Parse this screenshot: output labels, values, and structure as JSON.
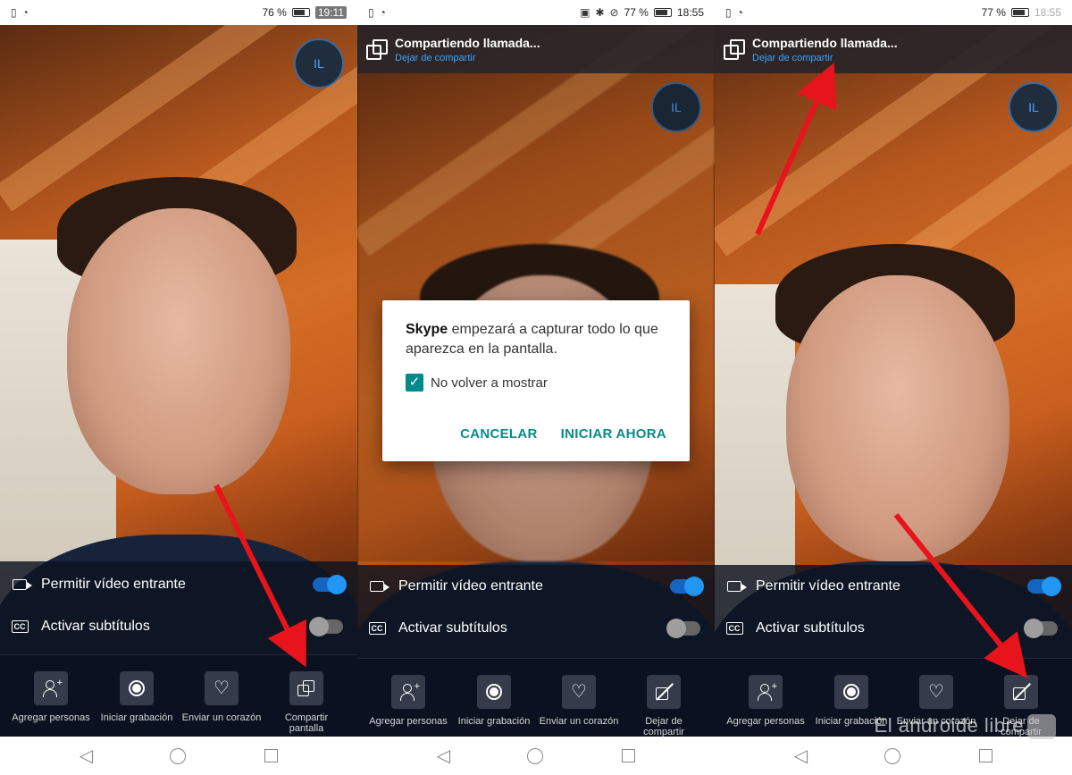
{
  "panels": [
    {
      "status": {
        "battery": "76 %",
        "time": "19:11"
      },
      "avatar": "IL",
      "settings": [
        {
          "label": "Permitir vídeo entrante",
          "on": true
        },
        {
          "label": "Activar subtítulos",
          "on": false
        }
      ],
      "actions": [
        {
          "label": "Agregar personas",
          "icon": "add-person-icon"
        },
        {
          "label": "Iniciar grabación",
          "icon": "record-icon"
        },
        {
          "label": "Enviar un corazón",
          "icon": "heart-icon"
        },
        {
          "label": "Compartir pantalla",
          "icon": "share-screen-icon"
        }
      ]
    },
    {
      "status": {
        "battery": "77 %",
        "time": "18:55"
      },
      "banner": {
        "title": "Compartiendo llamada...",
        "link": "Dejar de compartir"
      },
      "avatar": "IL",
      "dialog": {
        "app": "Skype",
        "message": " empezará a capturar todo lo que aparezca en la pantalla.",
        "checkbox_label": "No volver a mostrar",
        "cancel": "CANCELAR",
        "confirm": "INICIAR AHORA"
      },
      "settings": [
        {
          "label": "Permitir vídeo entrante",
          "on": true
        },
        {
          "label": "Activar subtítulos",
          "on": false
        }
      ],
      "actions": [
        {
          "label": "Agregar personas",
          "icon": "add-person-icon"
        },
        {
          "label": "Iniciar grabación",
          "icon": "record-icon"
        },
        {
          "label": "Enviar un corazón",
          "icon": "heart-icon"
        },
        {
          "label": "Dejar de compartir",
          "icon": "stop-share-icon"
        }
      ]
    },
    {
      "status": {
        "battery": "77 %",
        "time": "18:55"
      },
      "banner": {
        "title": "Compartiendo llamada...",
        "link": "Dejar de compartir"
      },
      "avatar": "IL",
      "settings": [
        {
          "label": "Permitir vídeo entrante",
          "on": true
        },
        {
          "label": "Activar subtítulos",
          "on": false
        }
      ],
      "actions": [
        {
          "label": "Agregar personas",
          "icon": "add-person-icon"
        },
        {
          "label": "Iniciar grabación",
          "icon": "record-icon"
        },
        {
          "label": "Enviar un corazón",
          "icon": "heart-icon"
        },
        {
          "label": "Dejar de compartir",
          "icon": "stop-share-icon"
        }
      ]
    }
  ],
  "watermark": "El androide libre",
  "colors": {
    "accent": "#2196f3",
    "link": "#39a3ff",
    "dialog_accent": "#0a8a8a",
    "arrow": "#e8141b"
  }
}
